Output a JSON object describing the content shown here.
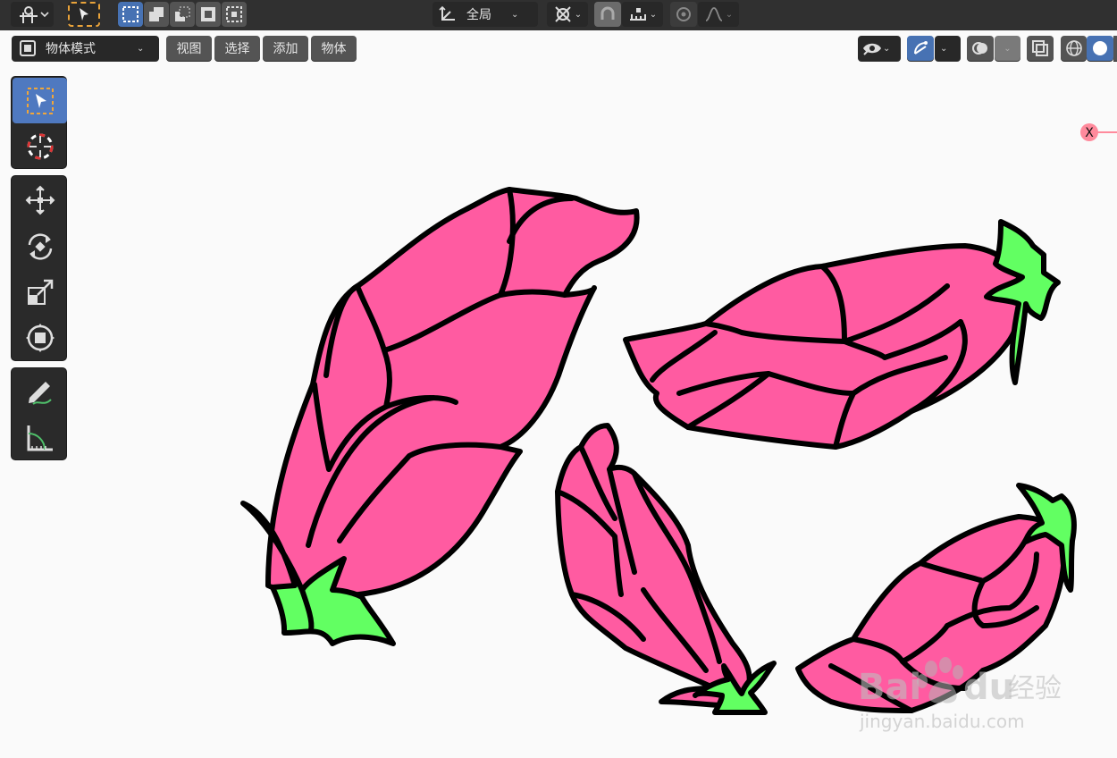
{
  "topbar": {
    "orientation_label": "全局"
  },
  "header": {
    "mode_label": "物体模式",
    "menus": [
      {
        "label": "视图"
      },
      {
        "label": "选择"
      },
      {
        "label": "添加"
      },
      {
        "label": "物体"
      }
    ]
  },
  "gizmo": {
    "axis_label": "X"
  },
  "colors": {
    "petal": "#ff5ba1",
    "leaf": "#62ff62",
    "outline": "#000000",
    "ui_dark": "#303030",
    "ui_button": "#545454",
    "ui_active": "#4772b3",
    "viewport": "#fafafa"
  },
  "icons": {
    "editor_type": "editor-type-icon",
    "select_box": "select-box-icon",
    "transform_orientation": "transform-orientation-icon",
    "pivot": "pivot-icon",
    "snap": "snap-icon",
    "proportional": "proportional-edit-icon",
    "visibility": "eye-icon",
    "gizmo": "gizmo-icon",
    "overlay": "overlay-icon",
    "xray": "xray-icon",
    "wireframe": "wireframe-shading-icon",
    "solid": "solid-shading-icon",
    "cursor": "cursor-icon",
    "move": "move-icon",
    "rotate": "rotate-icon",
    "scale": "scale-icon",
    "transform": "transform-icon",
    "annotate": "annotate-icon",
    "measure": "measure-icon"
  },
  "watermark": {
    "brand": "Bai",
    "brand2": "du",
    "suffix": "经验",
    "url": "jingyan.baidu.com"
  }
}
